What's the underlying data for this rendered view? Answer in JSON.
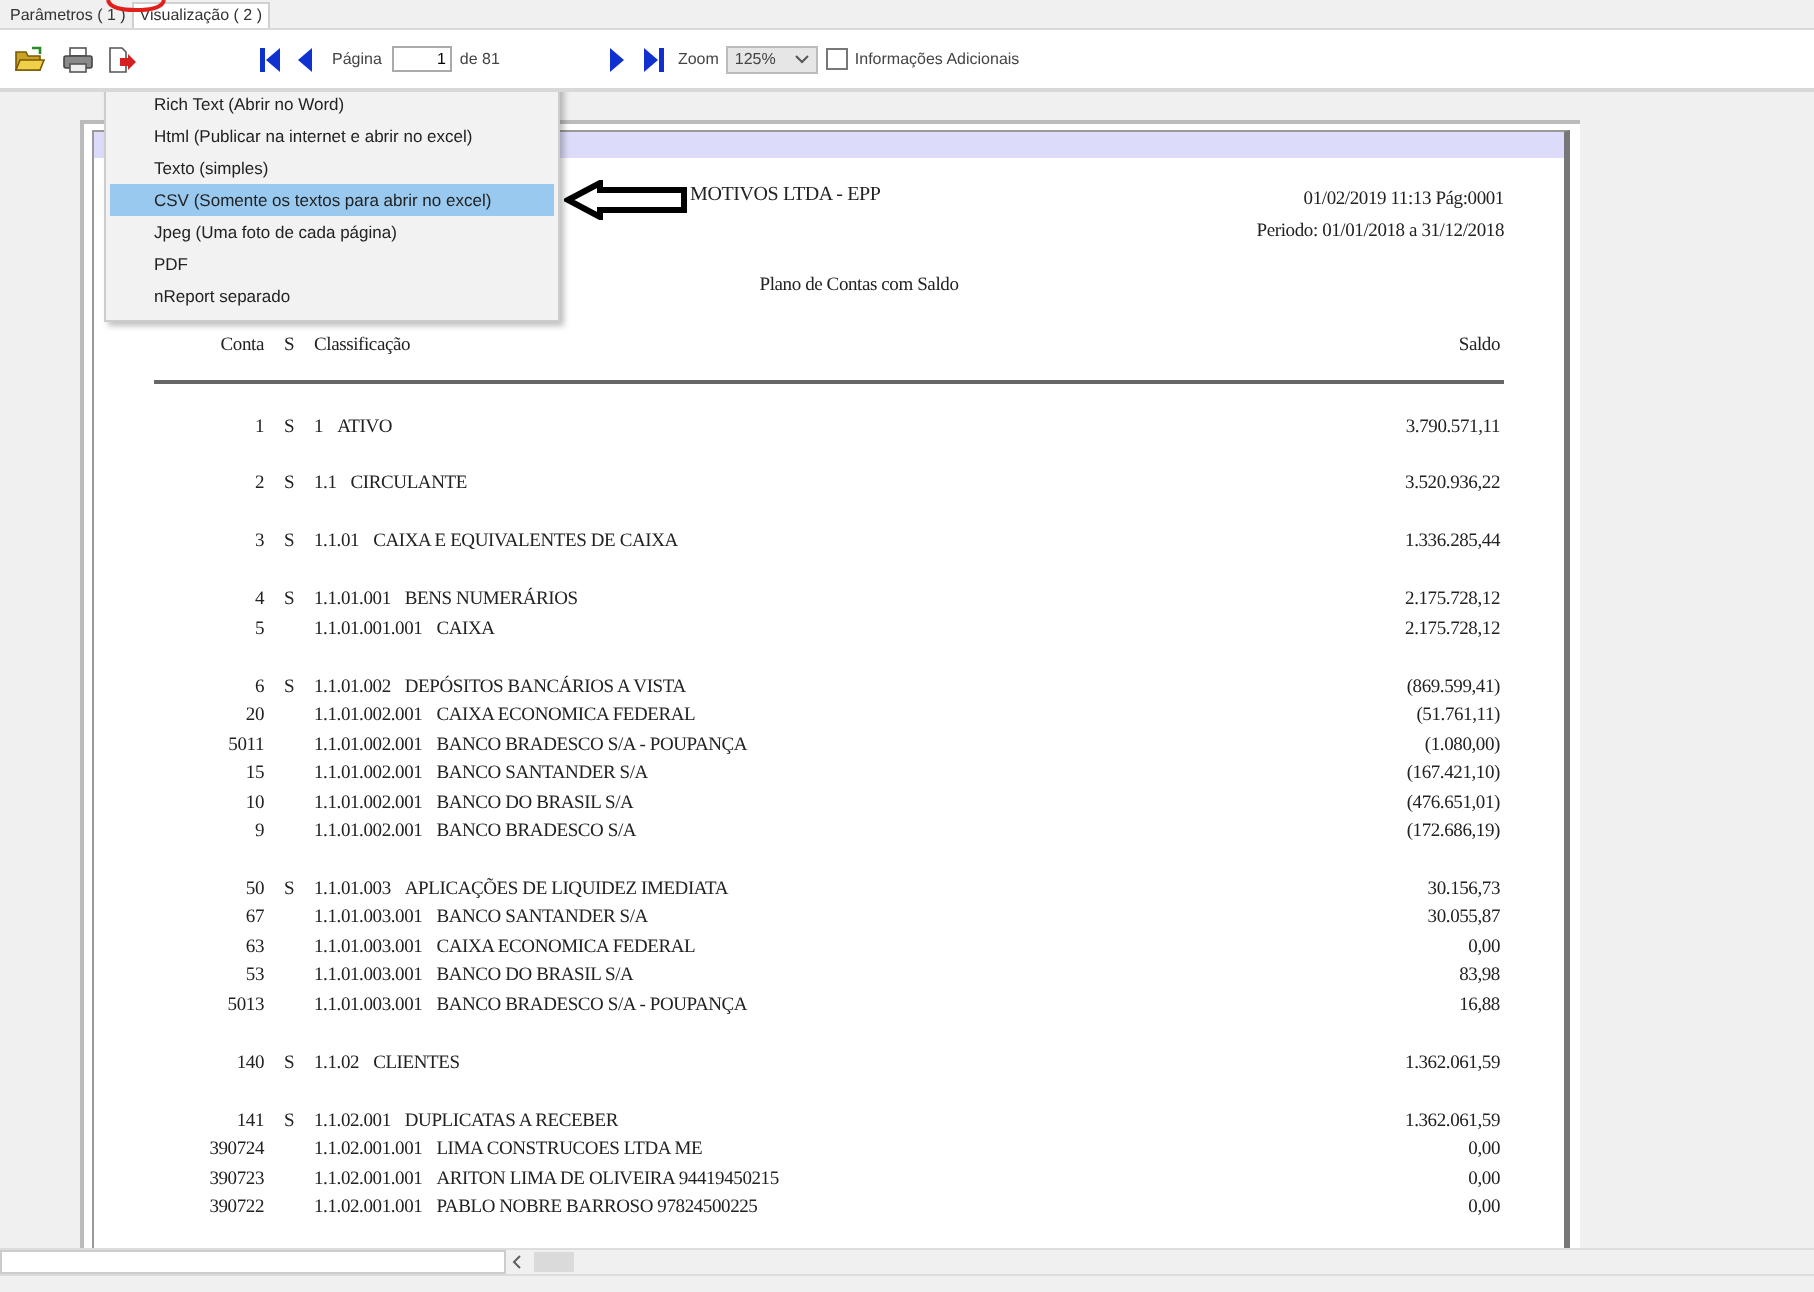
{
  "tabs": [
    {
      "label": "Parâmetros ( 1 )",
      "selected": false
    },
    {
      "label": "Visualização ( 2 )",
      "selected": true
    }
  ],
  "toolbar": {
    "page_label": "Página",
    "page_value": "1",
    "page_total": "de 81",
    "zoom_label": "Zoom",
    "zoom_value": "125%",
    "additional_info": {
      "label": "Informações Adicionais",
      "checked": false
    }
  },
  "export_menu": {
    "items": [
      {
        "label": "Rich Text (Abrir no Word)",
        "selected": false
      },
      {
        "label": "Html (Publicar na internet e abrir no excel)",
        "selected": false
      },
      {
        "label": "Texto (simples)",
        "selected": false
      },
      {
        "label": "CSV (Somente os textos para abrir no excel)",
        "selected": true
      },
      {
        "label": "Jpeg (Uma foto de cada página)",
        "selected": false
      },
      {
        "label": "PDF",
        "selected": false
      },
      {
        "label": "nReport separado",
        "selected": false
      }
    ]
  },
  "report": {
    "company": "MOTIVOS LTDA - EPP",
    "timestamp": "01/02/2019 11:13 Pág:0001",
    "period": "Periodo: 01/01/2018 a 31/12/2018",
    "title": "Plano de Contas com Saldo",
    "columns": [
      "Conta",
      "S",
      "Classificação",
      "Saldo"
    ],
    "groups": [
      {
        "rows": [
          {
            "conta": "1",
            "s": "S",
            "code": "1",
            "name": "ATIVO",
            "saldo": "3.790.571,11"
          }
        ]
      },
      {
        "rows": [
          {
            "conta": "2",
            "s": "S",
            "code": "1.1",
            "name": "CIRCULANTE",
            "saldo": "3.520.936,22"
          }
        ]
      },
      {
        "rows": [
          {
            "conta": "3",
            "s": "S",
            "code": "1.1.01",
            "name": "CAIXA E EQUIVALENTES DE CAIXA",
            "saldo": "1.336.285,44"
          }
        ]
      },
      {
        "rows": [
          {
            "conta": "4",
            "s": "S",
            "code": "1.1.01.001",
            "name": "BENS NUMERÁRIOS",
            "saldo": "2.175.728,12"
          },
          {
            "conta": "5",
            "code": "1.1.01.001.001",
            "name": "CAIXA",
            "saldo": "2.175.728,12"
          }
        ]
      },
      {
        "rows": [
          {
            "conta": "6",
            "s": "S",
            "code": "1.1.01.002",
            "name": "DEPÓSITOS BANCÁRIOS A VISTA",
            "saldo": "(869.599,41)"
          },
          {
            "conta": "20",
            "code": "1.1.01.002.001",
            "name": "CAIXA ECONOMICA FEDERAL",
            "saldo": "(51.761,11)"
          },
          {
            "conta": "5011",
            "code": "1.1.01.002.001",
            "name": "BANCO BRADESCO S/A - POUPANÇA",
            "saldo": "(1.080,00)"
          },
          {
            "conta": "15",
            "code": "1.1.01.002.001",
            "name": "BANCO SANTANDER S/A",
            "saldo": "(167.421,10)"
          },
          {
            "conta": "10",
            "code": "1.1.01.002.001",
            "name": "BANCO DO BRASIL S/A",
            "saldo": "(476.651,01)"
          },
          {
            "conta": "9",
            "code": "1.1.01.002.001",
            "name": "BANCO BRADESCO S/A",
            "saldo": "(172.686,19)"
          }
        ]
      },
      {
        "rows": [
          {
            "conta": "50",
            "s": "S",
            "code": "1.1.01.003",
            "name": "APLICAÇÕES DE LIQUIDEZ IMEDIATA",
            "saldo": "30.156,73"
          },
          {
            "conta": "67",
            "code": "1.1.01.003.001",
            "name": "BANCO SANTANDER S/A",
            "saldo": "30.055,87"
          },
          {
            "conta": "63",
            "code": "1.1.01.003.001",
            "name": "CAIXA ECONOMICA FEDERAL",
            "saldo": "0,00"
          },
          {
            "conta": "53",
            "code": "1.1.01.003.001",
            "name": "BANCO DO BRASIL S/A",
            "saldo": "83,98"
          },
          {
            "conta": "5013",
            "code": "1.1.01.003.001",
            "name": "BANCO BRADESCO S/A - POUPANÇA",
            "saldo": "16,88"
          }
        ]
      },
      {
        "rows": [
          {
            "conta": "140",
            "s": "S",
            "code": "1.1.02",
            "name": "CLIENTES",
            "saldo": "1.362.061,59"
          }
        ]
      },
      {
        "rows": [
          {
            "conta": "141",
            "s": "S",
            "code": "1.1.02.001",
            "name": "DUPLICATAS A RECEBER",
            "saldo": "1.362.061,59"
          },
          {
            "conta": "390724",
            "code": "1.1.02.001.001",
            "name": "LIMA CONSTRUCOES LTDA ME",
            "saldo": "0,00"
          },
          {
            "conta": "390723",
            "code": "1.1.02.001.001",
            "name": "ARITON LIMA DE OLIVEIRA 94419450215",
            "saldo": "0,00"
          },
          {
            "conta": "390722",
            "code": "1.1.02.001.001",
            "name": "PABLO NOBRE BARROSO 97824500225",
            "saldo": "0,00"
          }
        ]
      }
    ]
  }
}
